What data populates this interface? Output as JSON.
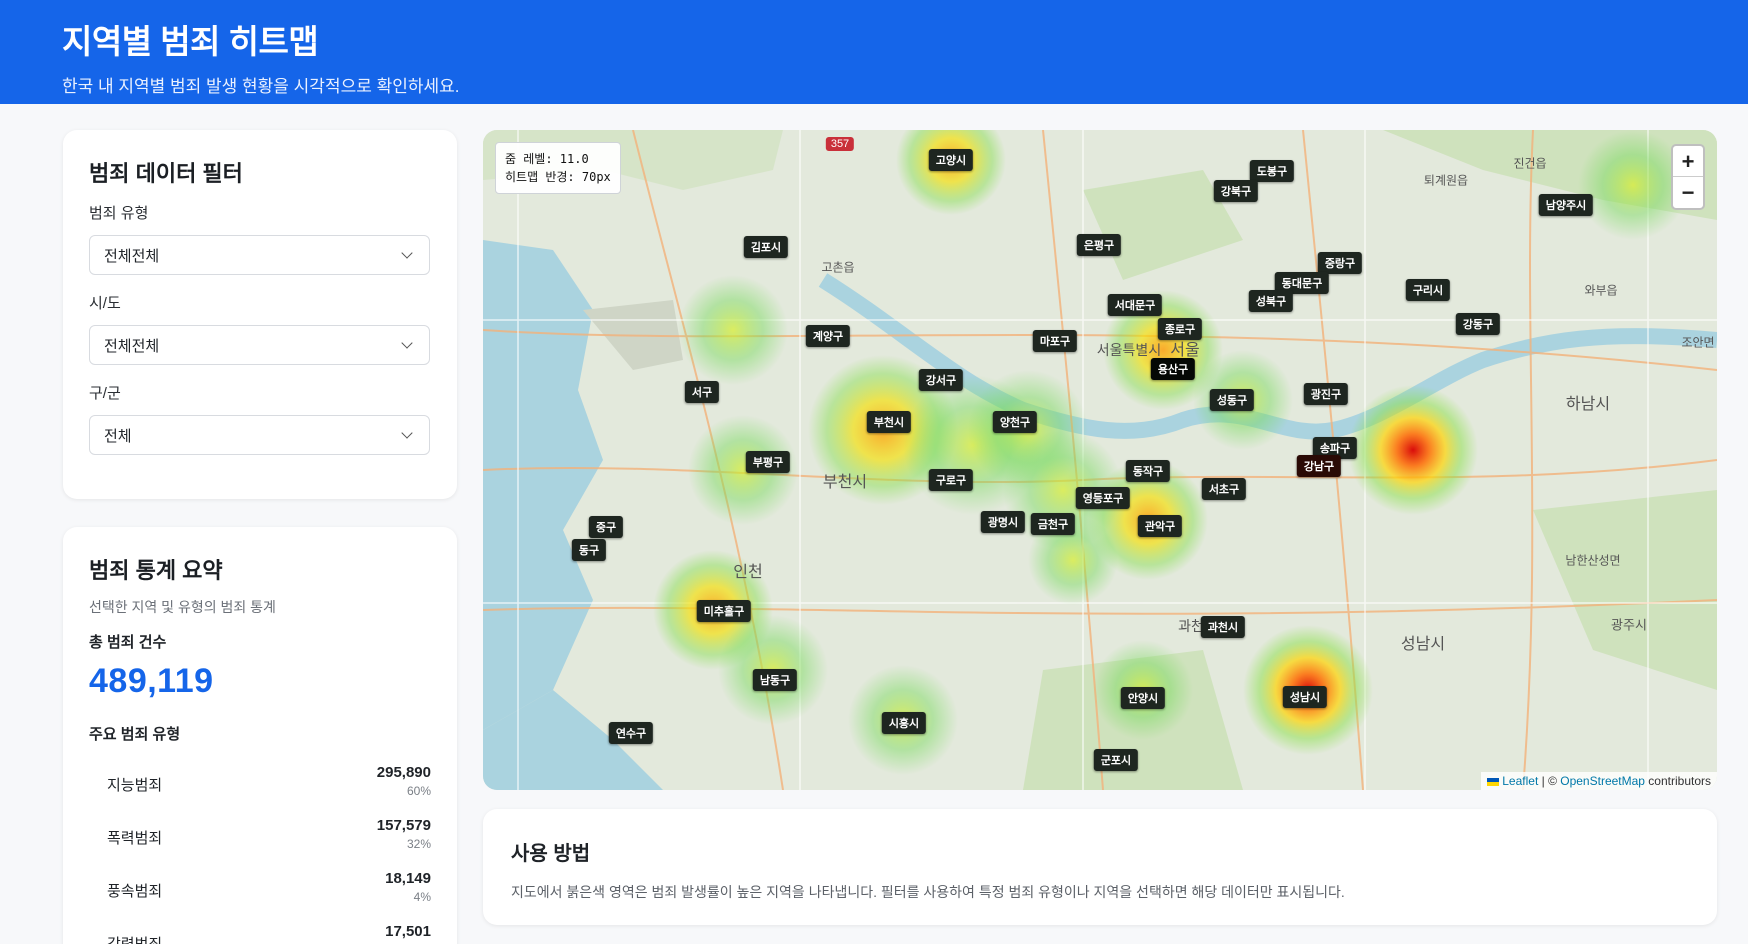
{
  "header": {
    "title": "지역별 범죄 히트맵",
    "subtitle": "한국 내 지역별 범죄 발생 현황을 시각적으로 확인하세요."
  },
  "filter": {
    "title": "범죄 데이터 필터",
    "crime_type_label": "범죄 유형",
    "crime_type_value": "전체전체",
    "sido_label": "시/도",
    "sido_value": "전체전체",
    "gugun_label": "구/군",
    "gugun_value": "전체"
  },
  "stats": {
    "title": "범죄 통계 요약",
    "subtitle": "선택한 지역 및 유형의 범죄 통계",
    "total_label": "총 범죄 건수",
    "total_value": "489,119",
    "types_label": "주요 범죄 유형",
    "types": [
      {
        "name": "지능범죄",
        "count": "295,890",
        "pct": "60%"
      },
      {
        "name": "폭력범죄",
        "count": "157,579",
        "pct": "32%"
      },
      {
        "name": "풍속범죄",
        "count": "18,149",
        "pct": "4%"
      },
      {
        "name": "강력범죄",
        "count": "17,501",
        "pct": "4%"
      }
    ]
  },
  "map": {
    "zoom_level_text": "줌 레벨: 11.0",
    "radius_text": "히트맵 반경: 70px",
    "zoom_in": "+",
    "zoom_out": "−",
    "attribution_leaflet": "Leaflet",
    "attribution_sep": " | © ",
    "attribution_osm": "OpenStreetMap",
    "attribution_tail": " contributors",
    "region_labels": [
      "고양시",
      "도봉구",
      "강북구",
      "김포시",
      "은평구",
      "중랑구",
      "동대문구",
      "구리시",
      "남양주시",
      "성북구",
      "서대문구",
      "종로구",
      "강동구",
      "계양구",
      "마포구",
      "용산구",
      "서구",
      "강서구",
      "성동구",
      "광진구",
      "부천시",
      "양천구",
      "송파구",
      "강남구",
      "부평구",
      "동작구",
      "구로구",
      "서초구",
      "영등포구",
      "광명시",
      "금천구",
      "관악구",
      "중구",
      "동구",
      "미추홀구",
      "과천시",
      "남동구",
      "안양시",
      "성남시",
      "시흥시",
      "연수구",
      "군포시"
    ],
    "background_labels": [
      "고촌읍",
      "부천시",
      "인천",
      "서울특별시",
      "서울",
      "하남시",
      "성남시",
      "광주시",
      "남한산성면",
      "퇴계원읍",
      "진건읍",
      "와부읍",
      "조안면",
      "과천",
      "357"
    ]
  },
  "usage": {
    "title": "사용 방법",
    "body": "지도에서 붉은색 영역은 범죄 발생률이 높은 지역을 나타냅니다. 필터를 사용하여 특정 범죄 유형이나 지역을 선택하면 해당 데이터만 표시됩니다."
  }
}
